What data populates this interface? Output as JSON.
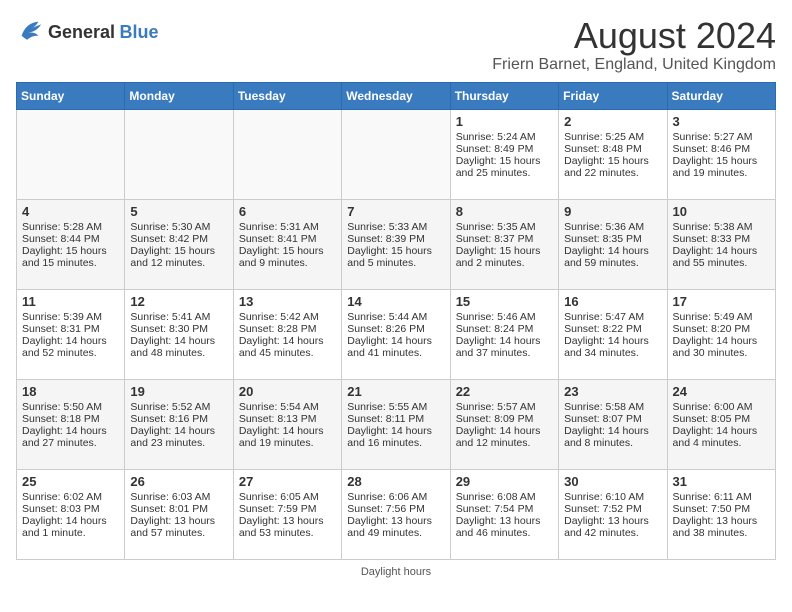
{
  "logo": {
    "general": "General",
    "blue": "Blue"
  },
  "title": "August 2024",
  "subtitle": "Friern Barnet, England, United Kingdom",
  "days_of_week": [
    "Sunday",
    "Monday",
    "Tuesday",
    "Wednesday",
    "Thursday",
    "Friday",
    "Saturday"
  ],
  "footer": "Daylight hours",
  "weeks": [
    [
      {
        "day": "",
        "content": ""
      },
      {
        "day": "",
        "content": ""
      },
      {
        "day": "",
        "content": ""
      },
      {
        "day": "",
        "content": ""
      },
      {
        "day": "1",
        "content": "Sunrise: 5:24 AM\nSunset: 8:49 PM\nDaylight: 15 hours and 25 minutes."
      },
      {
        "day": "2",
        "content": "Sunrise: 5:25 AM\nSunset: 8:48 PM\nDaylight: 15 hours and 22 minutes."
      },
      {
        "day": "3",
        "content": "Sunrise: 5:27 AM\nSunset: 8:46 PM\nDaylight: 15 hours and 19 minutes."
      }
    ],
    [
      {
        "day": "4",
        "content": "Sunrise: 5:28 AM\nSunset: 8:44 PM\nDaylight: 15 hours and 15 minutes."
      },
      {
        "day": "5",
        "content": "Sunrise: 5:30 AM\nSunset: 8:42 PM\nDaylight: 15 hours and 12 minutes."
      },
      {
        "day": "6",
        "content": "Sunrise: 5:31 AM\nSunset: 8:41 PM\nDaylight: 15 hours and 9 minutes."
      },
      {
        "day": "7",
        "content": "Sunrise: 5:33 AM\nSunset: 8:39 PM\nDaylight: 15 hours and 5 minutes."
      },
      {
        "day": "8",
        "content": "Sunrise: 5:35 AM\nSunset: 8:37 PM\nDaylight: 15 hours and 2 minutes."
      },
      {
        "day": "9",
        "content": "Sunrise: 5:36 AM\nSunset: 8:35 PM\nDaylight: 14 hours and 59 minutes."
      },
      {
        "day": "10",
        "content": "Sunrise: 5:38 AM\nSunset: 8:33 PM\nDaylight: 14 hours and 55 minutes."
      }
    ],
    [
      {
        "day": "11",
        "content": "Sunrise: 5:39 AM\nSunset: 8:31 PM\nDaylight: 14 hours and 52 minutes."
      },
      {
        "day": "12",
        "content": "Sunrise: 5:41 AM\nSunset: 8:30 PM\nDaylight: 14 hours and 48 minutes."
      },
      {
        "day": "13",
        "content": "Sunrise: 5:42 AM\nSunset: 8:28 PM\nDaylight: 14 hours and 45 minutes."
      },
      {
        "day": "14",
        "content": "Sunrise: 5:44 AM\nSunset: 8:26 PM\nDaylight: 14 hours and 41 minutes."
      },
      {
        "day": "15",
        "content": "Sunrise: 5:46 AM\nSunset: 8:24 PM\nDaylight: 14 hours and 37 minutes."
      },
      {
        "day": "16",
        "content": "Sunrise: 5:47 AM\nSunset: 8:22 PM\nDaylight: 14 hours and 34 minutes."
      },
      {
        "day": "17",
        "content": "Sunrise: 5:49 AM\nSunset: 8:20 PM\nDaylight: 14 hours and 30 minutes."
      }
    ],
    [
      {
        "day": "18",
        "content": "Sunrise: 5:50 AM\nSunset: 8:18 PM\nDaylight: 14 hours and 27 minutes."
      },
      {
        "day": "19",
        "content": "Sunrise: 5:52 AM\nSunset: 8:16 PM\nDaylight: 14 hours and 23 minutes."
      },
      {
        "day": "20",
        "content": "Sunrise: 5:54 AM\nSunset: 8:13 PM\nDaylight: 14 hours and 19 minutes."
      },
      {
        "day": "21",
        "content": "Sunrise: 5:55 AM\nSunset: 8:11 PM\nDaylight: 14 hours and 16 minutes."
      },
      {
        "day": "22",
        "content": "Sunrise: 5:57 AM\nSunset: 8:09 PM\nDaylight: 14 hours and 12 minutes."
      },
      {
        "day": "23",
        "content": "Sunrise: 5:58 AM\nSunset: 8:07 PM\nDaylight: 14 hours and 8 minutes."
      },
      {
        "day": "24",
        "content": "Sunrise: 6:00 AM\nSunset: 8:05 PM\nDaylight: 14 hours and 4 minutes."
      }
    ],
    [
      {
        "day": "25",
        "content": "Sunrise: 6:02 AM\nSunset: 8:03 PM\nDaylight: 14 hours and 1 minute."
      },
      {
        "day": "26",
        "content": "Sunrise: 6:03 AM\nSunset: 8:01 PM\nDaylight: 13 hours and 57 minutes."
      },
      {
        "day": "27",
        "content": "Sunrise: 6:05 AM\nSunset: 7:59 PM\nDaylight: 13 hours and 53 minutes."
      },
      {
        "day": "28",
        "content": "Sunrise: 6:06 AM\nSunset: 7:56 PM\nDaylight: 13 hours and 49 minutes."
      },
      {
        "day": "29",
        "content": "Sunrise: 6:08 AM\nSunset: 7:54 PM\nDaylight: 13 hours and 46 minutes."
      },
      {
        "day": "30",
        "content": "Sunrise: 6:10 AM\nSunset: 7:52 PM\nDaylight: 13 hours and 42 minutes."
      },
      {
        "day": "31",
        "content": "Sunrise: 6:11 AM\nSunset: 7:50 PM\nDaylight: 13 hours and 38 minutes."
      }
    ]
  ]
}
